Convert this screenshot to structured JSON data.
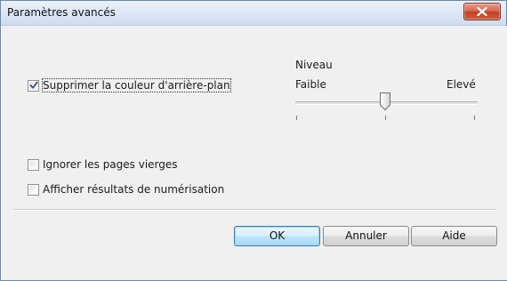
{
  "window": {
    "title": "Paramètres avancés",
    "close_icon": "close-x-icon"
  },
  "options": {
    "remove_background": {
      "label": "Supprimer la couleur d'arrière-plan",
      "checked": true
    },
    "ignore_blank_pages": {
      "label": "Ignorer les pages vierges",
      "checked": false
    },
    "show_scan_results": {
      "label": "Afficher résultats de numérisation",
      "checked": false
    }
  },
  "level_slider": {
    "title": "Niveau",
    "min_label": "Faible",
    "max_label": "Elevé",
    "steps": 3,
    "value_index": 1
  },
  "buttons": {
    "ok": "OK",
    "cancel": "Annuler",
    "help": "Aide"
  },
  "colors": {
    "close_button": "#c9452a",
    "default_button_border": "#3c7fb1",
    "dialog_background": "#f0f0f0"
  }
}
